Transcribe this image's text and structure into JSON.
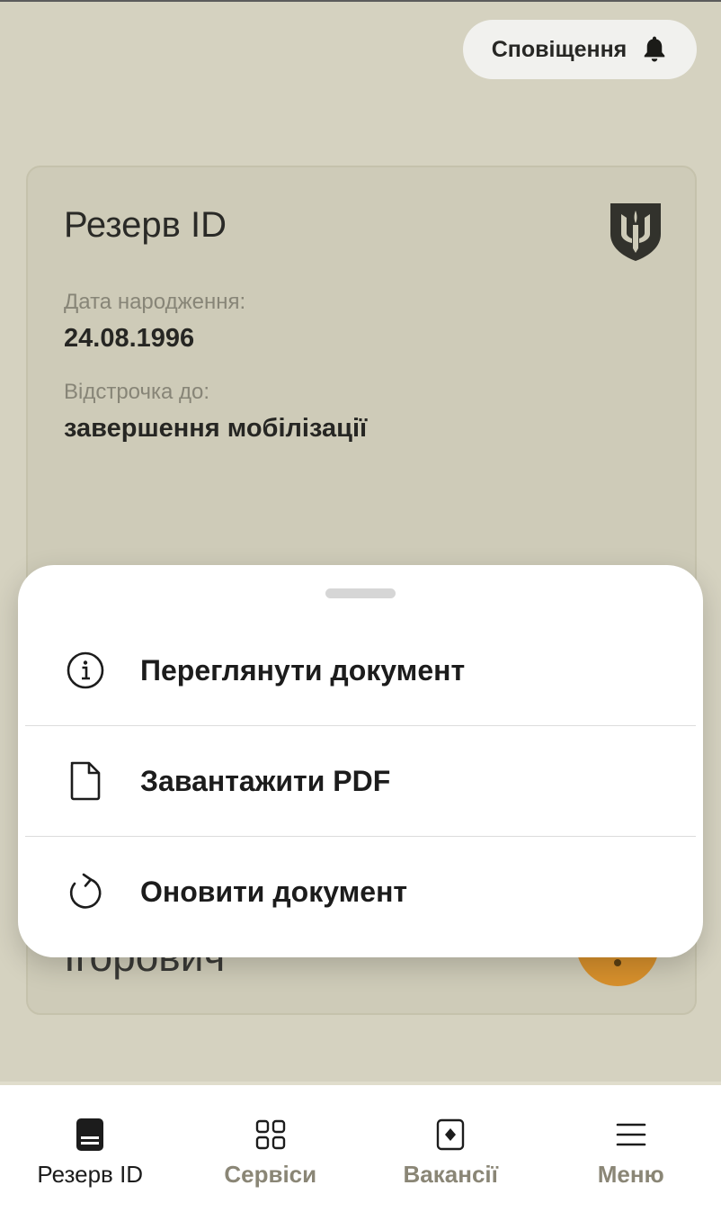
{
  "header": {
    "notifications_label": "Сповіщення",
    "notifications_icon": "bell-icon"
  },
  "card": {
    "title": "Резерв ID",
    "emblem_icon": "trident-shield-icon",
    "dob_label": "Дата народження:",
    "dob_value": "24.08.1996",
    "deferral_label": "Відстрочка до:",
    "deferral_value": "завершення мобілізації",
    "patronymic_partial": "Ігорович",
    "accent_color": "#e39327"
  },
  "sheet": {
    "items": [
      {
        "label": "Переглянути документ",
        "icon": "info-icon"
      },
      {
        "label": "Завантажити PDF",
        "icon": "file-icon"
      },
      {
        "label": "Оновити документ",
        "icon": "refresh-icon"
      }
    ]
  },
  "nav": {
    "items": [
      {
        "label": "Резерв ID",
        "icon": "document-icon",
        "active": true
      },
      {
        "label": "Сервіси",
        "icon": "grid-icon",
        "active": false
      },
      {
        "label": "Вакансії",
        "icon": "vacancy-icon",
        "active": false
      },
      {
        "label": "Меню",
        "icon": "menu-icon",
        "active": false
      }
    ]
  }
}
